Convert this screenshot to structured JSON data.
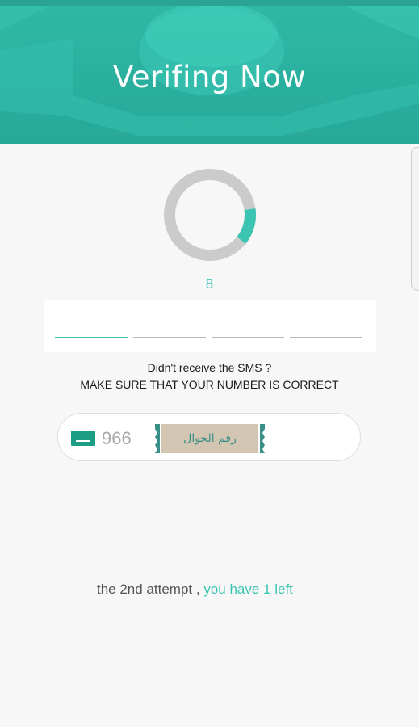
{
  "header": {
    "title": "Verifing Now"
  },
  "timer": {
    "value": "8",
    "progress_fraction": 0.13
  },
  "code": {
    "slots": 4,
    "filled": 1
  },
  "messages": {
    "line1": "Didn't receive the SMS ?",
    "line2": "MAKE SURE THAT YOUR NUMBER IS CORRECT"
  },
  "phone": {
    "country_code": "966",
    "placeholder": "رقم الجوال",
    "flag_icon": "saudi-flag-icon"
  },
  "attempt": {
    "text": "the 2nd attempt ,",
    "remaining": "you have 1 left"
  },
  "colors": {
    "accent": "#3cc4b2",
    "header": "#2fb8a6"
  }
}
